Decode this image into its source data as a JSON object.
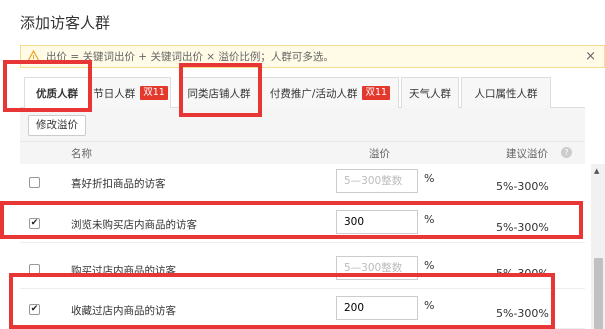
{
  "dialog": {
    "title": "添加访客人群"
  },
  "notice": {
    "text": "出价 = 关键词出价 + 关键词出价 × 溢价比例；人群可多选。",
    "close": "×"
  },
  "tabs": [
    {
      "label": "优质人群",
      "badge": ""
    },
    {
      "label": "节日人群",
      "badge": "双11"
    },
    {
      "label": "同类店铺人群",
      "badge": ""
    },
    {
      "label": "付费推广/活动人群",
      "badge": "双11"
    },
    {
      "label": "天气人群",
      "badge": ""
    },
    {
      "label": "人口属性人群",
      "badge": ""
    }
  ],
  "toolbar": {
    "modify_label": "修改溢价"
  },
  "table": {
    "headers": {
      "name": "名称",
      "price": "溢价",
      "suggest": "建议溢价",
      "help": "?"
    },
    "rows": [
      {
        "name": "喜好折扣商品的访客",
        "value": "",
        "placeholder": "5—300整数",
        "pct": "%",
        "suggest": "5%-300%",
        "checked": ""
      },
      {
        "name": "浏览未购买店内商品的访客",
        "value": "300",
        "placeholder": "",
        "pct": "%",
        "suggest": "5%-300%",
        "checked": "✔"
      },
      {
        "name": "购买过店内商品的访客",
        "value": "",
        "placeholder": "5—300整数",
        "pct": "%",
        "suggest": "5%-300%",
        "checked": ""
      },
      {
        "name": "收藏过店内商品的访客",
        "value": "200",
        "placeholder": "",
        "pct": "%",
        "suggest": "5%-300%",
        "checked": "✔"
      }
    ]
  },
  "scrollbar": {
    "up": "▲"
  },
  "colors": {
    "accent": "#e83535",
    "badge": "#e5382d",
    "notice_bg": "#fffbe6"
  }
}
